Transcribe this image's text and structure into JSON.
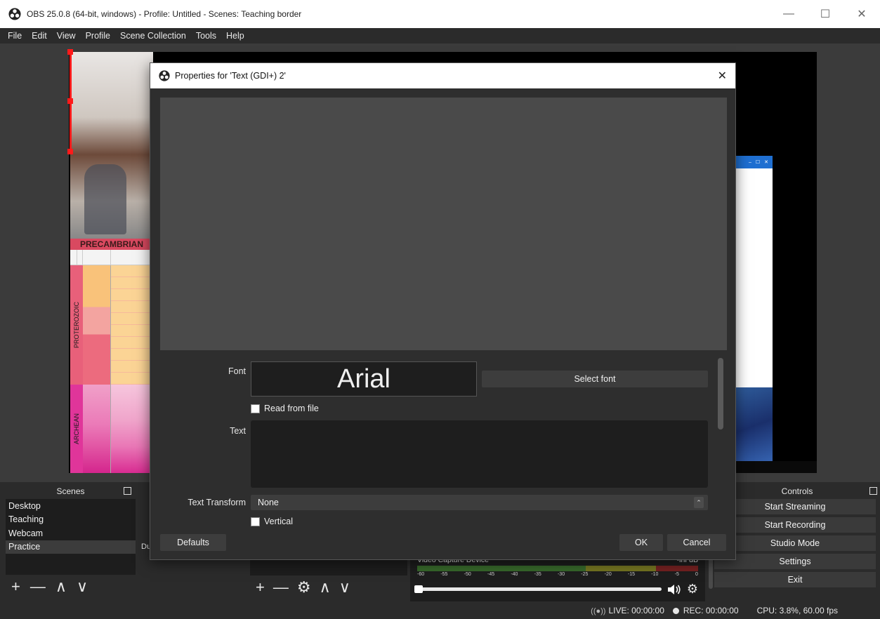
{
  "window": {
    "title": "OBS 25.0.8 (64-bit, windows) - Profile: Untitled - Scenes: Teaching border",
    "minimize": "—",
    "maximize": "☐",
    "close": "✕"
  },
  "menu": [
    "File",
    "Edit",
    "View",
    "Profile",
    "Scene Collection",
    "Tools",
    "Help"
  ],
  "preview": {
    "chart_heading": "PRECAMBRIAN",
    "eons": [
      "PROTEROZOIC",
      "ARCHEAN"
    ]
  },
  "scenes": {
    "title": "Scenes",
    "items": [
      "Desktop",
      "Teaching",
      "Webcam",
      "Practice"
    ],
    "selected": "Practice",
    "toolbar": {
      "add": "+",
      "remove": "—",
      "up": "∧",
      "down": "∨"
    }
  },
  "sources": {
    "partial_label": "Du",
    "toolbar": {
      "add": "+",
      "remove": "—",
      "settings": "⚙",
      "up": "∧",
      "down": "∨"
    }
  },
  "mixer": {
    "device": "Video Capture Device",
    "level": "-inf dB",
    "ticks": [
      "-60",
      "-55",
      "-50",
      "-45",
      "-40",
      "-35",
      "-30",
      "-25",
      "-20",
      "-15",
      "-10",
      "-5",
      "0"
    ],
    "volume_fraction": 0.0
  },
  "controls": {
    "title": "Controls",
    "buttons": [
      "Start Streaming",
      "Start Recording",
      "Studio Mode",
      "Settings",
      "Exit"
    ]
  },
  "status": {
    "live": "LIVE: 00:00:00",
    "rec": "REC: 00:00:00",
    "cpu": "CPU: 3.8%, 60.00 fps"
  },
  "dialog": {
    "title": "Properties for 'Text (GDI+) 2'",
    "close": "✕",
    "font_label": "Font",
    "font_value": "Arial",
    "select_font": "Select font",
    "read_from_file": "Read from file",
    "text_label": "Text",
    "text_value": "",
    "transform_label": "Text Transform",
    "transform_value": "None",
    "vertical": "Vertical",
    "defaults": "Defaults",
    "ok": "OK",
    "cancel": "Cancel"
  },
  "colors": {
    "accent_selection": "#ff1a1a",
    "chart_header": "#d94960"
  }
}
